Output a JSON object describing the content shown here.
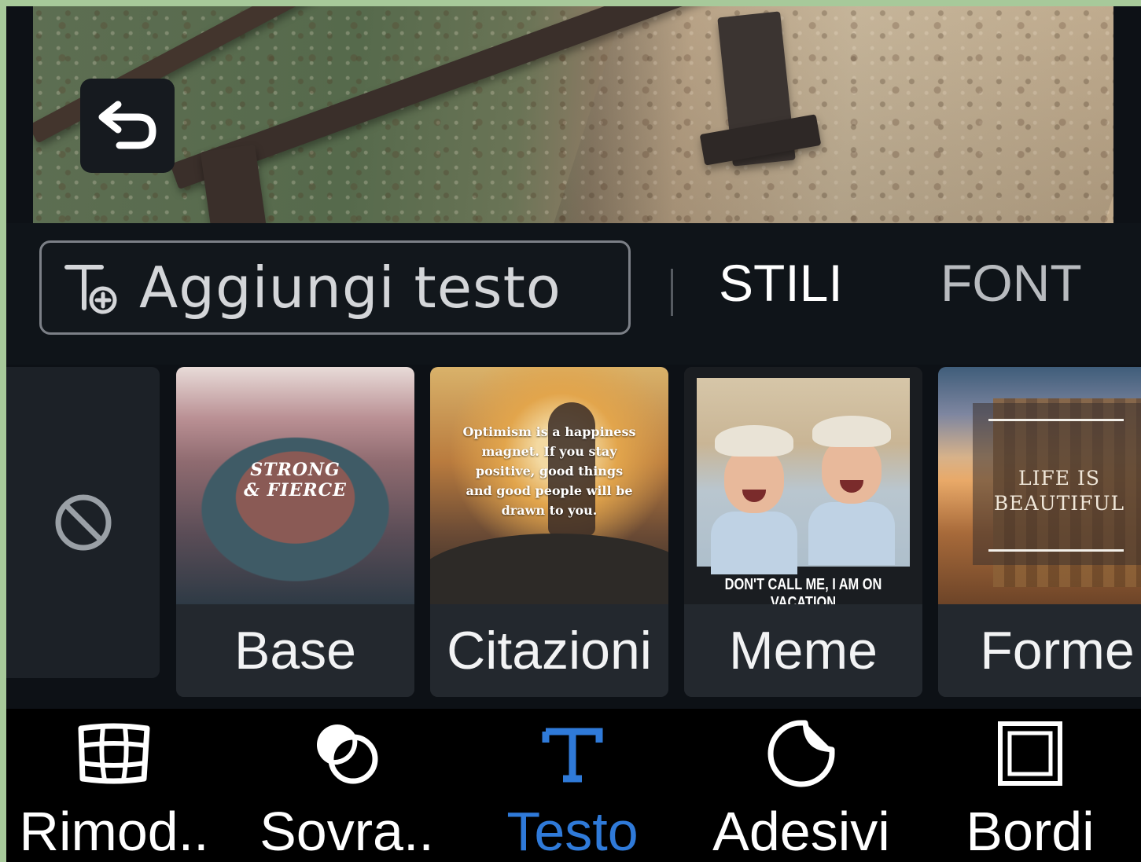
{
  "editor": {
    "undo_icon": "undo-icon"
  },
  "text_toolbar": {
    "add_text_label": "Aggiungi testo",
    "add_text_icon": "add-text-icon",
    "tabs": [
      {
        "label": "STILI",
        "active": true
      },
      {
        "label": "FONT",
        "active": false
      }
    ]
  },
  "styles": {
    "none_icon": "no-style-icon",
    "items": [
      {
        "label": "Base",
        "thumb_text": "STRONG\n& FIERCE"
      },
      {
        "label": "Citazioni",
        "thumb_text": "Optimism is a happiness magnet. If you stay positive, good things and good people will be drawn to you."
      },
      {
        "label": "Meme",
        "thumb_text": "DON'T CALL ME, I AM ON VACATION"
      },
      {
        "label": "Forme",
        "thumb_text": "LIFE IS BEAUTIFUL"
      }
    ]
  },
  "bottom_nav": {
    "active_color": "#2f7ad9",
    "items": [
      {
        "label": "Rimod..",
        "icon": "reshape-grid-icon"
      },
      {
        "label": "Sovra..",
        "icon": "overlay-circles-icon"
      },
      {
        "label": "Testo",
        "icon": "text-icon",
        "active": true
      },
      {
        "label": "Adesivi",
        "icon": "sticker-icon"
      },
      {
        "label": "Bordi",
        "icon": "border-frame-icon"
      }
    ]
  }
}
